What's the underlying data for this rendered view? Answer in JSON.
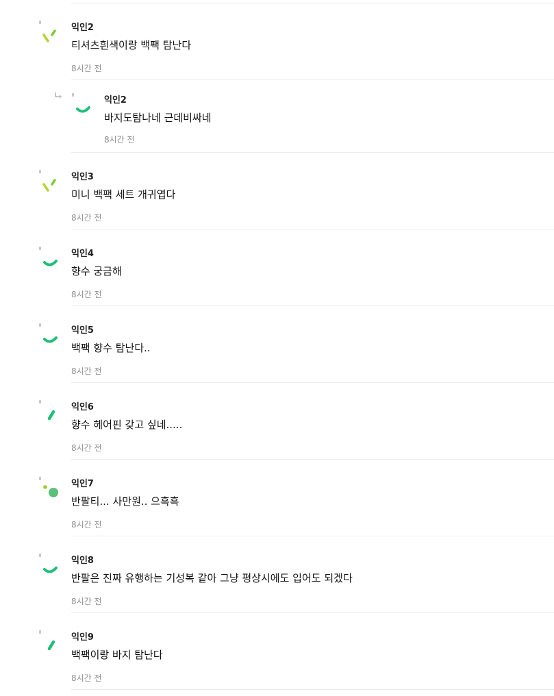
{
  "comments": [
    {
      "author": "익인2",
      "text": "티셔츠흰색이랑 백팩 탐난다",
      "time": "8시간 전",
      "avatar_icon": "dash-pair-lime-icon",
      "reply": false
    },
    {
      "author": "익인2",
      "text": "바지도탐나네 근데비싸네",
      "time": "8시간 전",
      "avatar_icon": "smile-arc-green-icon",
      "reply": true
    },
    {
      "author": "익인3",
      "text": "미니 백팩 세트 개귀엽다",
      "time": "8시간 전",
      "avatar_icon": "dash-pair-lime-icon",
      "reply": false
    },
    {
      "author": "익인4",
      "text": "향수 궁금해",
      "time": "8시간 전",
      "avatar_icon": "smile-arc-green-icon",
      "reply": false
    },
    {
      "author": "익인5",
      "text": "백팩 향수 탐난다..",
      "time": "8시간 전",
      "avatar_icon": "smile-arc-green-icon",
      "reply": false
    },
    {
      "author": "익인6",
      "text": "향수 헤어핀 갖고 싶네.....",
      "time": "8시간 전",
      "avatar_icon": "slash-green-icon",
      "reply": false
    },
    {
      "author": "익인7",
      "text": "반팔티... 사만원.. 으흑흑",
      "time": "8시간 전",
      "avatar_icon": "dot-pair-green-icon",
      "reply": false
    },
    {
      "author": "익인8",
      "text": "반팔은 진짜 유행하는 기성복 같아 그냥 평상시에도 입어도 되겠다",
      "time": "8시간 전",
      "avatar_icon": "smile-arc-green-icon",
      "reply": false
    },
    {
      "author": "익인9",
      "text": "백팩이랑 바지 탐난다",
      "time": "8시간 전",
      "avatar_icon": "slash-green-icon",
      "reply": false
    }
  ],
  "colors": {
    "lime": "#b5d334",
    "green": "#1fbf7a",
    "dot_green": "#5cc07b",
    "small_dot_lime": "#9ccc2c",
    "muted": "#8f8f8f",
    "divider": "#ececec",
    "reply_arrow": "#c4c4c4"
  },
  "reply_arrow_icon": "reply-arrow-icon"
}
